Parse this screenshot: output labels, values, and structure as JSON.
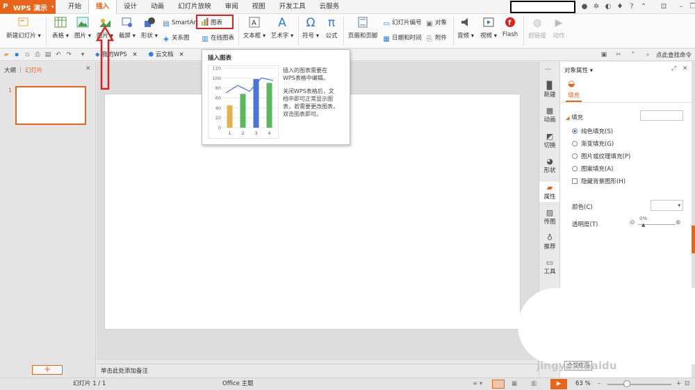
{
  "app": {
    "title": "WPS 演示"
  },
  "menu": {
    "tabs": [
      "开始",
      "插入",
      "设计",
      "动画",
      "幻灯片放映",
      "审阅",
      "视图",
      "开发工具",
      "云服务"
    ],
    "active_tab": "插入"
  },
  "ribbon": {
    "new_slide": "新建幻灯片",
    "table": "表格",
    "picture": "图片",
    "chart_partial": "图片",
    "screenshot": "截屏",
    "shape": "形状",
    "smartart": "SmartArt",
    "relation": "关系图",
    "chart": "图表",
    "online_chart": "在线图表",
    "textbox": "文本框",
    "wordart": "艺术字",
    "symbol": "符号",
    "formula": "公式",
    "header_footer": "页眉和页脚",
    "slide_number": "幻灯片编号",
    "datetime": "日期和时间",
    "object": "对象",
    "attachment": "附件",
    "audio": "音频",
    "video": "视频",
    "flash": "Flash",
    "hyperlink": "超链接",
    "action": "动作",
    "symbol_glyph": "Ω",
    "formula_glyph": "π",
    "wordart_glyph": "A"
  },
  "quickbar": {
    "doc_tab": "我的WPS",
    "cloud_tab": "云文档",
    "search": "点此查找命令"
  },
  "left_panel": {
    "outline_tab": "大纲",
    "slides_tab": "幻灯片",
    "slide_index": "1",
    "add": "+"
  },
  "tooltip": {
    "title": "插入图表",
    "line1": "插入的图表需要在",
    "line2": "WPS表格中编辑。",
    "line3": "关闭WPS表格后，文",
    "line4": "档中即可正常显示图",
    "line5": "表，若需要更改图表，",
    "line6": "双击图表即可。"
  },
  "chart_data": {
    "type": "bar",
    "categories": [
      "1",
      "2",
      "3",
      "4"
    ],
    "values": [
      45,
      68,
      98,
      90
    ],
    "line_values": [
      70,
      85,
      73,
      100,
      95
    ],
    "ylim": [
      0,
      120
    ],
    "yticks": [
      "120",
      "100",
      "80",
      "60",
      "40",
      "20",
      "0"
    ],
    "bar_colors": [
      "#e3b24a",
      "#5cb85c",
      "#4a74d8",
      "#5cb85c"
    ]
  },
  "notes": {
    "placeholder": "单击此处添加备注"
  },
  "rail": {
    "items": [
      "新建",
      "动画",
      "切换",
      "形状",
      "属性",
      "传图",
      "推荐",
      "工具"
    ]
  },
  "props": {
    "header": "对象属性",
    "tab": "填充",
    "section": "填充",
    "options": [
      "纯色填充(S)",
      "渐变填充(G)",
      "图片或纹理填充(P)",
      "图案填充(A)"
    ],
    "hide_bg": "隐藏背景图形(H)",
    "color_label": "颜色(C)",
    "transparency_label": "透明度(T)",
    "transparency_value": "0%",
    "apply_all": "全部应用"
  },
  "status": {
    "slide": "幻灯片 1 / 1",
    "theme": "Office 主题",
    "zoom": "63 %"
  },
  "watermark": "jingyan.baidu",
  "colors": {
    "accent": "#e8641b",
    "highlight_red": "#e02020"
  }
}
